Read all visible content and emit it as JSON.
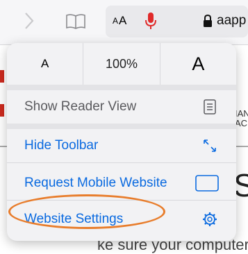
{
  "toolbar": {
    "text_size_button": {
      "small": "A",
      "large": "A"
    },
    "url_partial": "aapp",
    "icons": [
      "chevron-right-icon",
      "book-icon",
      "microphone-icon",
      "lock-icon"
    ]
  },
  "background": {
    "fragment_1": "IAN",
    "fragment_2": "AC",
    "big_letter": "S",
    "bottom_text": "ke sure your computer"
  },
  "menu": {
    "text_size": {
      "decrease": "A",
      "zoom": "100%",
      "increase": "A"
    },
    "items": [
      {
        "label": "Show Reader View",
        "enabled": false,
        "icon": "reader-view-icon"
      },
      {
        "label": "Hide Toolbar",
        "enabled": true,
        "icon": "collapse-arrows-icon"
      },
      {
        "label": "Request Mobile Website",
        "enabled": true,
        "icon": "mobile-frame-icon"
      },
      {
        "label": "Website Settings",
        "enabled": true,
        "icon": "gear-icon"
      }
    ]
  },
  "colors": {
    "accent_blue": "#0a6ae0",
    "mic_red": "#e02a2a",
    "highlight_orange": "#e87d2c",
    "disabled_gray": "#5a5a5e"
  }
}
